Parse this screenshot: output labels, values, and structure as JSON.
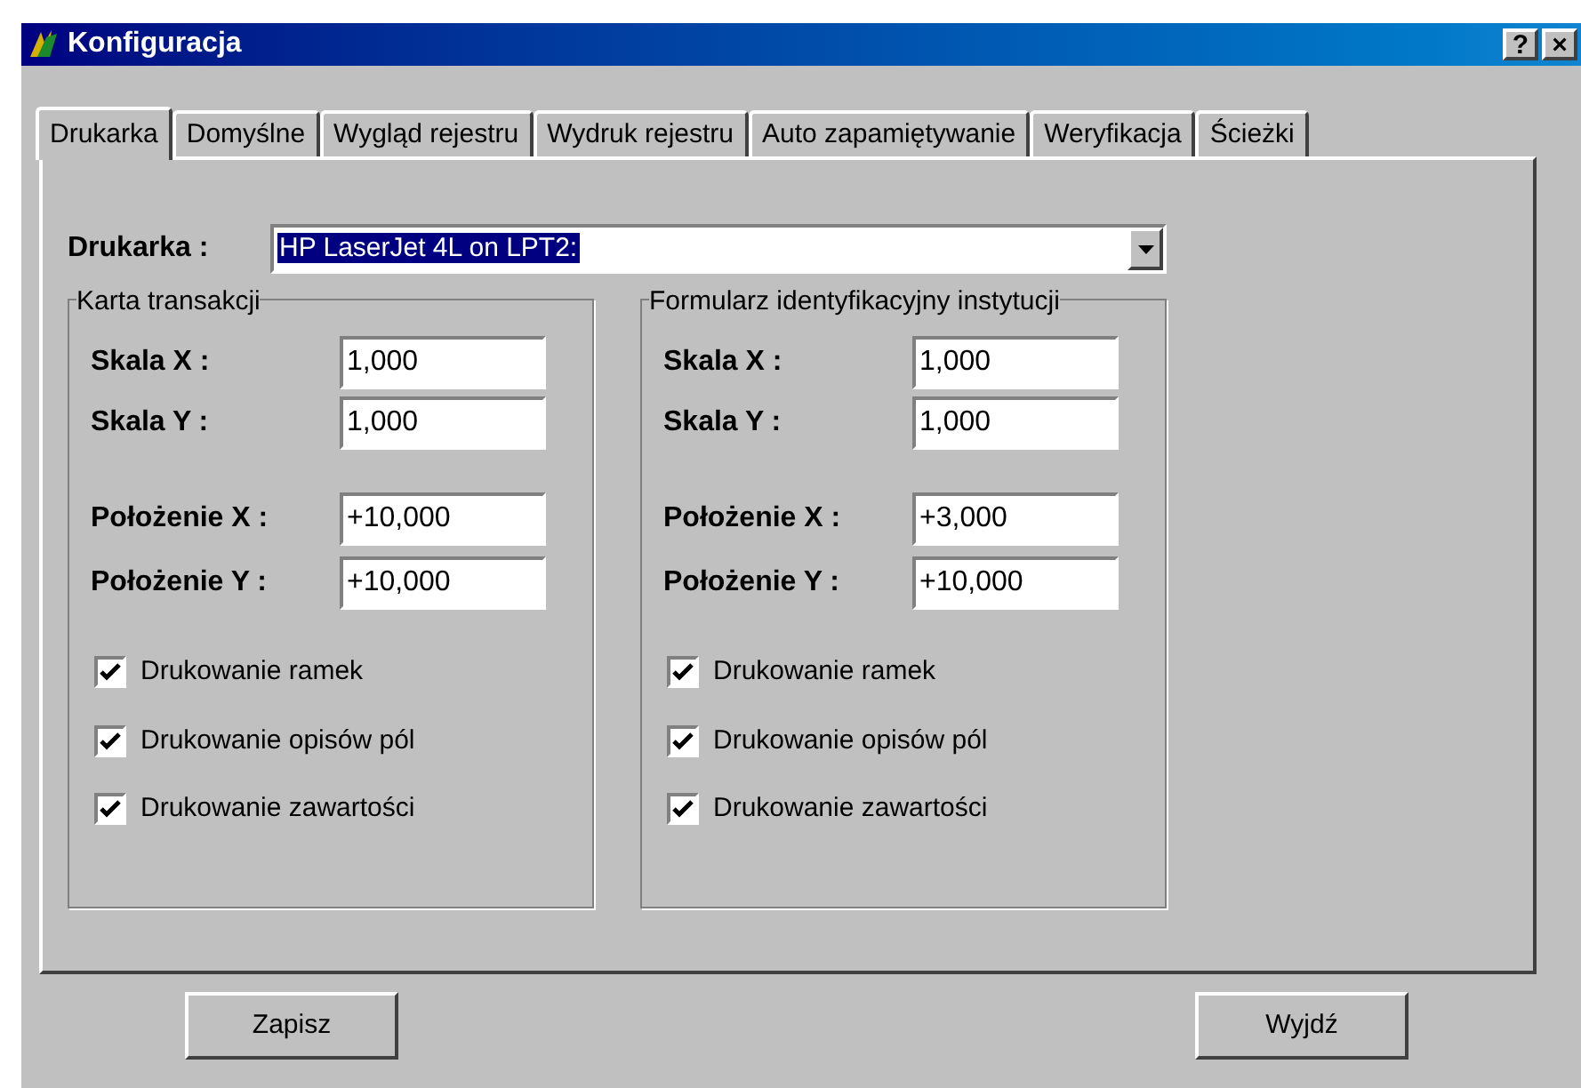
{
  "window": {
    "title": "Konfiguracja",
    "buttons": [
      "?",
      "×"
    ]
  },
  "tabs": [
    {
      "label": "Drukarka",
      "selected": true
    },
    {
      "label": "Domyślne",
      "selected": false
    },
    {
      "label": "Wygląd rejestru",
      "selected": false
    },
    {
      "label": "Wydruk rejestru",
      "selected": false
    },
    {
      "label": "Auto zapamiętywanie",
      "selected": false
    },
    {
      "label": "Weryfikacja",
      "selected": false
    },
    {
      "label": "Ścieżki",
      "selected": false
    }
  ],
  "printer": {
    "label": "Drukarka :",
    "value": "HP LaserJet 4L on LPT2:"
  },
  "groups": [
    {
      "title": "Karta transakcji",
      "fields": [
        {
          "label": "Skala X :",
          "value": "1,000"
        },
        {
          "label": "Skala Y :",
          "value": "1,000"
        },
        {
          "label": "Położenie X :",
          "value": "+10,000"
        },
        {
          "label": "Położenie Y :",
          "value": "+10,000"
        }
      ],
      "options": [
        {
          "label": "Drukowanie ramek",
          "checked": true
        },
        {
          "label": "Drukowanie opisów pól",
          "checked": true
        },
        {
          "label": "Drukowanie zawartości",
          "checked": true
        }
      ]
    },
    {
      "title": "Formularz identyfikacyjny instytucji",
      "fields": [
        {
          "label": "Skala X :",
          "value": "1,000"
        },
        {
          "label": "Skala Y :",
          "value": "1,000"
        },
        {
          "label": "Położenie X :",
          "value": "+3,000"
        },
        {
          "label": "Położenie Y :",
          "value": "+10,000"
        }
      ],
      "options": [
        {
          "label": "Drukowanie ramek",
          "checked": true
        },
        {
          "label": "Drukowanie opisów pól",
          "checked": true
        },
        {
          "label": "Drukowanie zawartości",
          "checked": true
        }
      ]
    }
  ],
  "buttons": [
    "Zapisz",
    "Wyjdź"
  ]
}
